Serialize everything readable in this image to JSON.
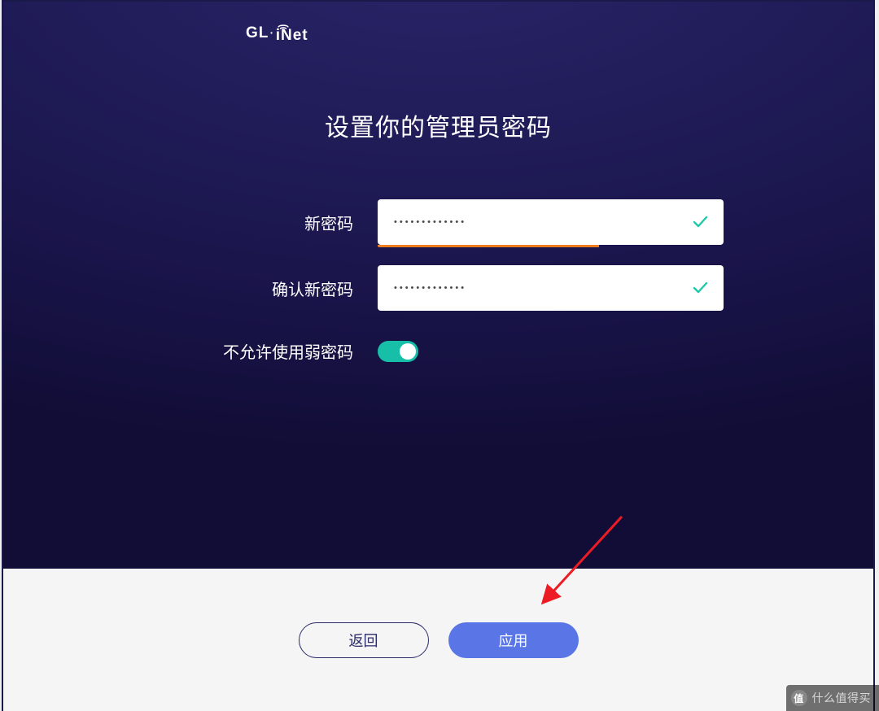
{
  "brand": {
    "prefix": "GL",
    "dot": "·",
    "suffix": "iNet"
  },
  "title": "设置你的管理员密码",
  "form": {
    "new_password_label": "新密码",
    "new_password_value": "•••••••••••••",
    "new_password_valid": true,
    "strength_fraction": 0.64,
    "confirm_password_label": "确认新密码",
    "confirm_password_value": "•••••••••••••",
    "confirm_password_valid": true,
    "weak_password_label": "不允许使用弱密码",
    "weak_password_toggle_on": true
  },
  "buttons": {
    "back_label": "返回",
    "apply_label": "应用"
  },
  "watermark": {
    "badge": "值",
    "text": "什么值得买"
  },
  "colors": {
    "accent_teal": "#17bfa8",
    "primary_blue": "#5975e6",
    "strength_orange": "#ef7e1f",
    "bg_deep_indigo": "#191449"
  }
}
